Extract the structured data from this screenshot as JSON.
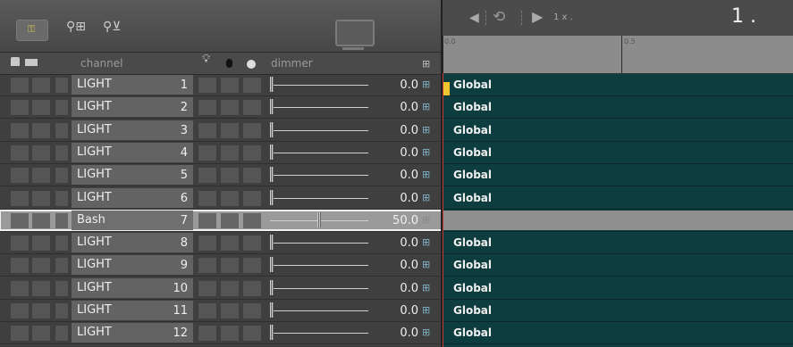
{
  "toolbar": {
    "lock_icon": "lock-icon",
    "group_icon": "group-icon",
    "filter_icon": "filter-icon",
    "monitor_icon": "monitor-icon"
  },
  "header": {
    "channel": "channel",
    "dimmer": "dimmer"
  },
  "rows": [
    {
      "name": "LIGHT",
      "num": "1",
      "value": "0.0",
      "level": 0.0
    },
    {
      "name": "LIGHT",
      "num": "2",
      "value": "0.0",
      "level": 0.0
    },
    {
      "name": "LIGHT",
      "num": "3",
      "value": "0.0",
      "level": 0.0
    },
    {
      "name": "LIGHT",
      "num": "4",
      "value": "0.0",
      "level": 0.0
    },
    {
      "name": "LIGHT",
      "num": "5",
      "value": "0.0",
      "level": 0.0
    },
    {
      "name": "LIGHT",
      "num": "6",
      "value": "0.0",
      "level": 0.0
    },
    {
      "name": "Bash",
      "num": "7",
      "value": "50.0",
      "level": 0.5,
      "selected": true
    },
    {
      "name": "LIGHT",
      "num": "8",
      "value": "0.0",
      "level": 0.0
    },
    {
      "name": "LIGHT",
      "num": "9",
      "value": "0.0",
      "level": 0.0
    },
    {
      "name": "LIGHT",
      "num": "10",
      "value": "0.0",
      "level": 0.0
    },
    {
      "name": "LIGHT",
      "num": "11",
      "value": "0.0",
      "level": 0.0
    },
    {
      "name": "LIGHT",
      "num": "12",
      "value": "0.0",
      "level": 0.0
    }
  ],
  "timeline": {
    "speed": "1 x .",
    "frame": "1 .",
    "ruler_labels": [
      "0.0",
      "0.5"
    ],
    "track_label": "Global"
  },
  "colors": {
    "track_bg": "#0e3d3f",
    "playhead": "#f0c630",
    "selected_row": "#9a9a9a"
  }
}
